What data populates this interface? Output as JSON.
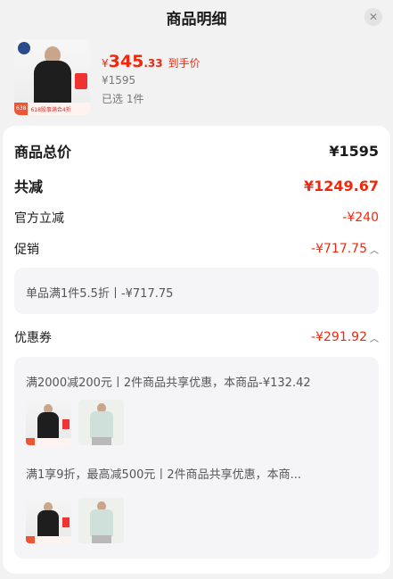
{
  "header": {
    "title": "商品明细",
    "close_icon": "close-icon"
  },
  "product": {
    "yen": "¥",
    "price_int": "345",
    "price_dec": ".33",
    "price_suffix": "到手价",
    "original_price": "¥1595",
    "selected_count": "已选 1件",
    "image_badge_tag": "638",
    "image_banner_text": "618股事满合4折"
  },
  "summary": {
    "total_label": "商品总价",
    "total_value": "¥1595",
    "reduction_label": "共减",
    "reduction_value": "¥1249.67",
    "official_label": "官方立减",
    "official_value": "-¥240",
    "promo_label": "促销",
    "promo_value": "-¥717.75",
    "promo_detail": "单品满1件5.5折丨-¥717.75",
    "coupon_label": "优惠券",
    "coupon_value": "-¥291.92",
    "coupon_detail_1": "满2000减200元丨2件商品共享优惠，本商品-¥132.42",
    "coupon_detail_2": "满1享9折，最高减500元丨2件商品共享优惠，本商..."
  },
  "colors": {
    "accent": "#f2270c",
    "card_bg": "#ffffff",
    "page_bg": "#f2f2f2",
    "sub_box_bg": "#f5f5f7"
  }
}
